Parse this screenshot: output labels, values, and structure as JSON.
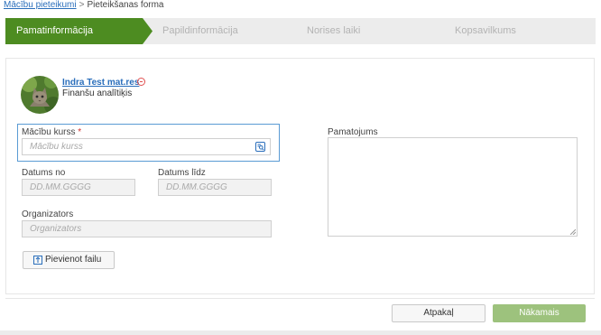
{
  "breadcrumb": {
    "link": "Mācību pieteikumi",
    "separator": ">",
    "current": "Pieteikšanas forma"
  },
  "steps": [
    {
      "label": "Pamatinformācija",
      "active": true
    },
    {
      "label": "Papildinformācija",
      "active": false
    },
    {
      "label": "Norises laiki",
      "active": false
    },
    {
      "label": "Kopsavilkums",
      "active": false
    }
  ],
  "user": {
    "name": "Indra Test mat.res",
    "role": "Finanšu analītiķis",
    "status_icon": "minus-circle-icon"
  },
  "form": {
    "course": {
      "label": "Mācību kurss",
      "required_mark": "*",
      "placeholder": "Mācību kurss",
      "lookup_icon": "search-list-icon"
    },
    "date_from": {
      "label": "Datums no",
      "placeholder": "DD.MM.GGGG"
    },
    "date_to": {
      "label": "Datums līdz",
      "placeholder": "DD.MM.GGGG"
    },
    "organizer": {
      "label": "Organizators",
      "placeholder": "Organizators"
    },
    "justification": {
      "label": "Pamatojums",
      "value": ""
    },
    "attach_button": "Pievienot failu"
  },
  "footer": {
    "back_label": "Atpakaļ",
    "next_label": "Nākamais"
  },
  "colors": {
    "accent_green": "#4d8c21",
    "next_button": "#9dc27d",
    "link_blue": "#2a6ebb",
    "focus_blue": "#5a9bd4",
    "required_red": "#d0312d"
  }
}
